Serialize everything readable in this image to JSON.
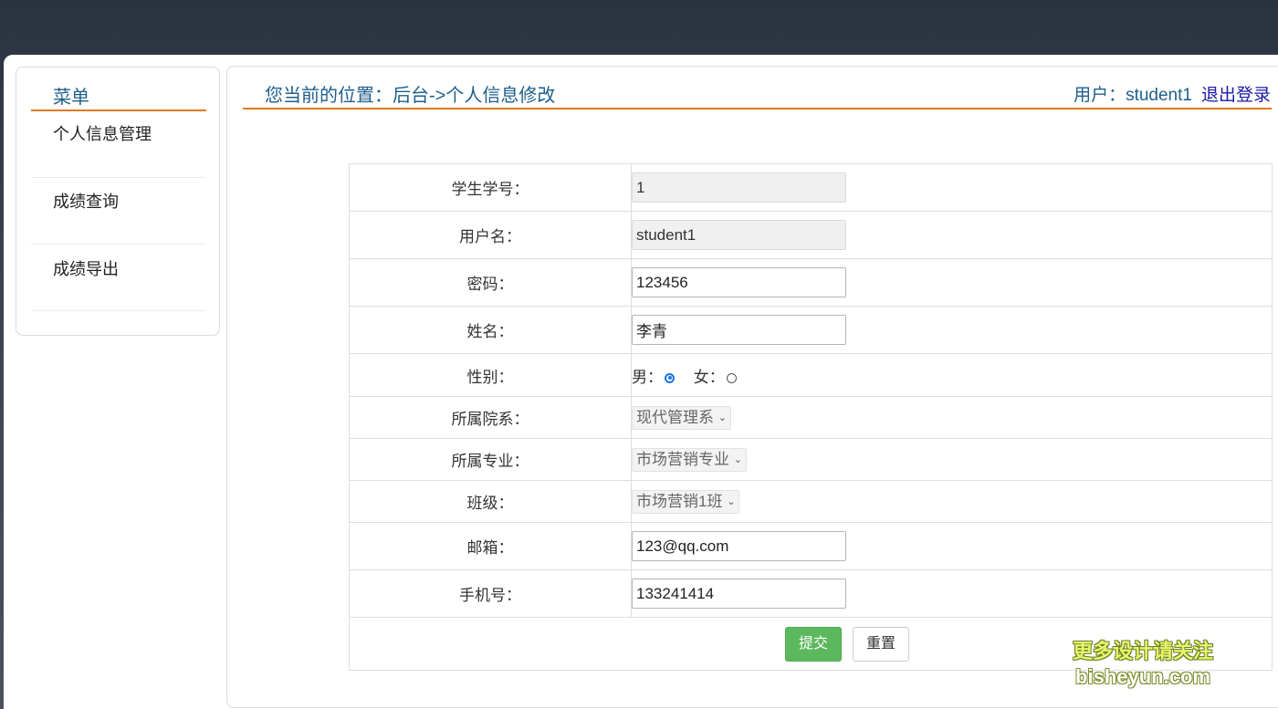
{
  "sidebar": {
    "title": "菜单",
    "items": [
      {
        "label": "个人信息管理"
      },
      {
        "label": "成绩查询"
      },
      {
        "label": "成绩导出"
      }
    ]
  },
  "header": {
    "breadcrumb": "您当前的位置：后台->个人信息修改",
    "user_label": "用户：student1",
    "logout": "退出登录"
  },
  "form": {
    "student_id": {
      "label": "学生学号：",
      "value": "1"
    },
    "username": {
      "label": "用户名：",
      "value": "student1"
    },
    "password": {
      "label": "密码：",
      "value": "123456"
    },
    "name": {
      "label": "姓名：",
      "value": "李青"
    },
    "gender": {
      "label": "性别：",
      "male": "男：",
      "female": "女：",
      "selected": "男"
    },
    "department": {
      "label": "所属院系：",
      "value": "现代管理系"
    },
    "major": {
      "label": "所属专业：",
      "value": "市场营销专业"
    },
    "class": {
      "label": "班级：",
      "value": "市场营销1班"
    },
    "email": {
      "label": "邮箱：",
      "value": "123@qq.com"
    },
    "phone": {
      "label": "手机号：",
      "value": "133241414"
    },
    "submit": "提交",
    "reset": "重置"
  },
  "watermark": {
    "line1": "更多设计请关注",
    "line2": "bisheyun.com"
  },
  "colors": {
    "accent_line": "#e07b1f",
    "title_blue": "#1f5f8b",
    "submit_green": "#5cb85c",
    "radio_blue": "#1a73e8"
  }
}
